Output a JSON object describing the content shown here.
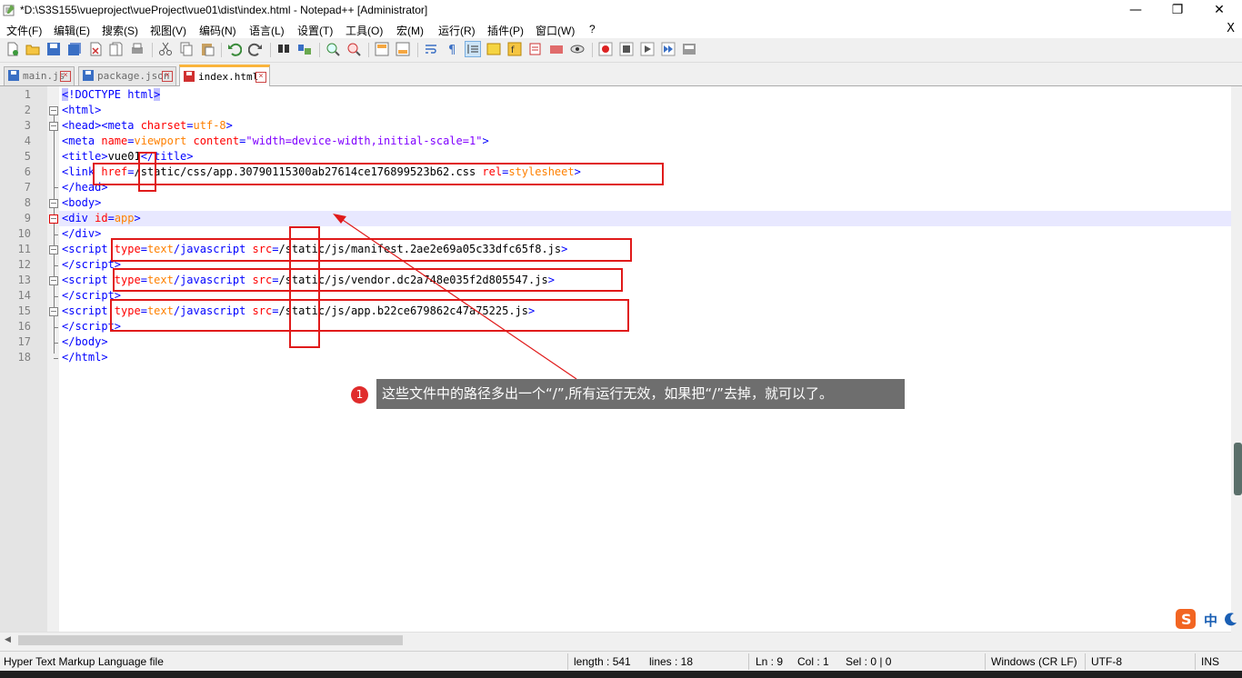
{
  "window": {
    "title": "*D:\\S3S155\\vueproject\\vueProject\\vue01\\dist\\index.html - Notepad++ [Administrator]",
    "minimize": "—",
    "restore": "❐",
    "close": "✕"
  },
  "menu": {
    "items": [
      "文件(F)",
      "编辑(E)",
      "搜索(S)",
      "视图(V)",
      "编码(N)",
      "语言(L)",
      "设置(T)",
      "工具(O)",
      "宏(M)",
      "运行(R)",
      "插件(P)",
      "窗口(W)",
      "?"
    ],
    "close": "X"
  },
  "tabs": [
    {
      "label": "main.js",
      "active": false
    },
    {
      "label": "package.json",
      "active": false
    },
    {
      "label": "index.html",
      "active": true
    }
  ],
  "editor": {
    "line_numbers": [
      "1",
      "2",
      "3",
      "4",
      "5",
      "6",
      "7",
      "8",
      "9",
      "10",
      "11",
      "12",
      "13",
      "14",
      "15",
      "16",
      "17",
      "18"
    ],
    "current_line": 9
  },
  "annotation": {
    "number": "1",
    "text": "这些文件中的路径多出一个“/”,所有运行无效，如果把“/”去掉，就可以了。"
  },
  "ime": {
    "label": "中"
  },
  "status": {
    "file_type": "Hyper Text Markup Language file",
    "length": "length : 541",
    "lines": "lines : 18",
    "ln": "Ln : 9",
    "col": "Col : 1",
    "sel": "Sel : 0 | 0",
    "eol": "Windows (CR LF)",
    "encoding": "UTF-8",
    "mode": "INS"
  },
  "colors": {
    "tag": "#0000ff",
    "attribute": "#ff0000",
    "value": "#ff8000",
    "string": "#8000ff",
    "highlight_box": "#e01a1a",
    "active_tab_accent": "#fab43c"
  }
}
